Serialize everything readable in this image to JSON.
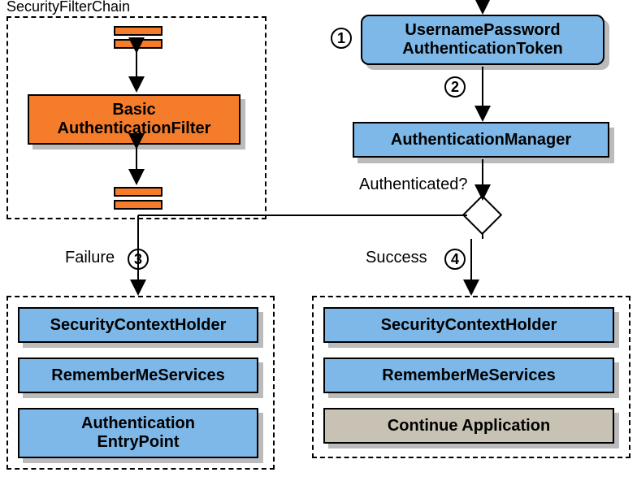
{
  "panel_title": "SecurityFilterChain",
  "filter": {
    "line1": "Basic",
    "line2": "AuthenticationFilter"
  },
  "badges": {
    "b1": "1",
    "b2": "2",
    "b3": "3",
    "b4": "4"
  },
  "token": {
    "line1": "UsernamePassword",
    "line2": "AuthenticationToken"
  },
  "manager": "AuthenticationManager",
  "decision_label": "Authenticated?",
  "failure_label": "Failure",
  "success_label": "Success",
  "failure": {
    "a": "SecurityContextHolder",
    "b": "RememberMeServices",
    "c_line1": "Authentication",
    "c_line2": "EntryPoint"
  },
  "success": {
    "a": "SecurityContextHolder",
    "b": "RememberMeServices",
    "c": "Continue Application"
  }
}
